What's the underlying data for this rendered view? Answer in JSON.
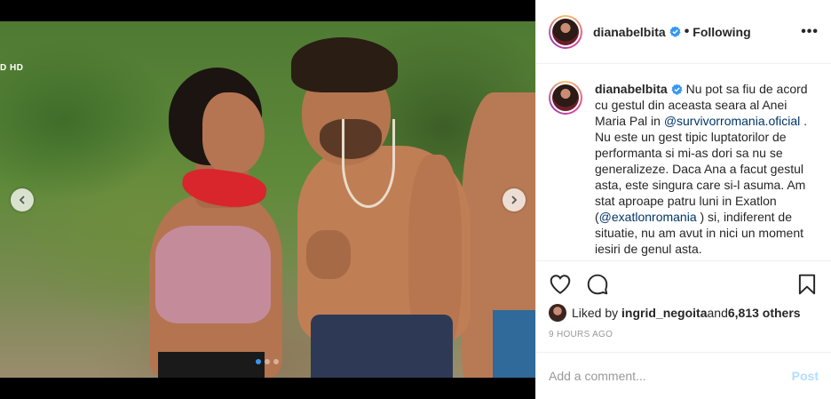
{
  "media": {
    "hd_badge": "D HD",
    "dots_count": 3,
    "active_dot": 1
  },
  "header": {
    "username": "dianabelbita",
    "separator": "•",
    "follow_status": "Following",
    "more_label": "•••"
  },
  "caption": {
    "username": "dianabelbita",
    "text_1": " Nu pot sa fiu de acord cu gestul din aceasta seara al Anei Maria Pal in ",
    "mention_1": "@survivorromania.oficial",
    "text_2": " . Nu este un gest tipic luptatorilor de performanta si mi-as dori sa nu se generalizeze. Daca Ana a facut gestul asta, este singura care si-l asuma. Am stat aproape patru luni in Exatlon (",
    "mention_2": "@exatlonromania",
    "text_3": " ) si, indiferent de situatie, nu am avut in nici un moment iesiri de genul asta."
  },
  "likes": {
    "prefix": "Liked by ",
    "liker": "ingrid_negoita",
    "middle": " and ",
    "others": "6,813 others"
  },
  "timestamp": "9 HOURS AGO",
  "comment_box": {
    "placeholder": "Add a comment...",
    "post_label": "Post"
  },
  "colors": {
    "verified_blue": "#3897f0",
    "link": "#003569",
    "post_disabled": "#b2dffc",
    "muted": "#999999"
  }
}
